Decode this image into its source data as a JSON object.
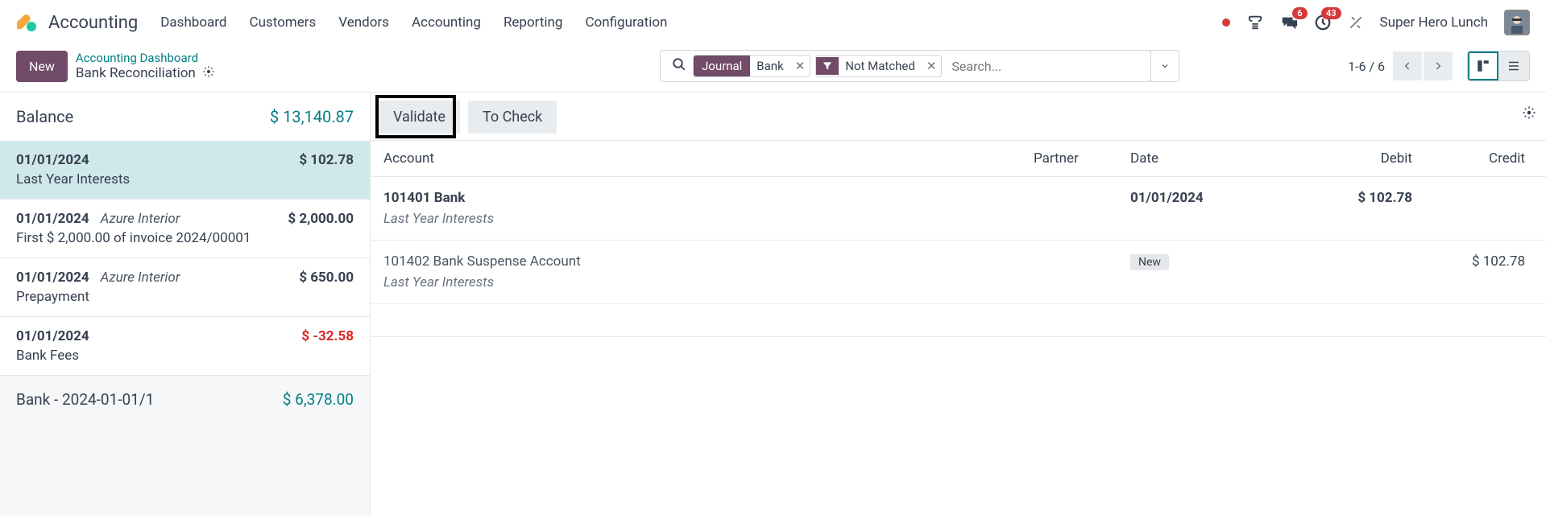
{
  "header": {
    "app": "Accounting",
    "menu": [
      "Dashboard",
      "Customers",
      "Vendors",
      "Accounting",
      "Reporting",
      "Configuration"
    ],
    "chat_badge": "6",
    "activity_badge": "43",
    "company": "Super Hero Lunch"
  },
  "breadcrumb": {
    "new_label": "New",
    "link": "Accounting Dashboard",
    "current": "Bank Reconciliation"
  },
  "search": {
    "chip1_label": "Journal",
    "chip1_value": "Bank",
    "chip2_value": "Not Matched",
    "placeholder": "Search...",
    "pager": "1-6 / 6"
  },
  "sidebar": {
    "balance_label": "Balance",
    "balance_amount": "$ 13,140.87",
    "statements": [
      {
        "date": "01/01/2024",
        "partner": "",
        "amount": "$ 102.78",
        "neg": false,
        "desc": "Last Year Interests",
        "active": true
      },
      {
        "date": "01/01/2024",
        "partner": "Azure Interior",
        "amount": "$ 2,000.00",
        "neg": false,
        "desc": "First $ 2,000.00 of invoice 2024/00001",
        "active": false
      },
      {
        "date": "01/01/2024",
        "partner": "Azure Interior",
        "amount": "$ 650.00",
        "neg": false,
        "desc": "Prepayment",
        "active": false
      },
      {
        "date": "01/01/2024",
        "partner": "",
        "amount": "$ -32.58",
        "neg": true,
        "desc": "Bank Fees",
        "active": false
      }
    ],
    "bank_label": "Bank - 2024-01-01/1",
    "bank_amount": "$ 6,378.00"
  },
  "content": {
    "tabs": {
      "validate": "Validate",
      "to_check": "To Check"
    },
    "columns": {
      "account": "Account",
      "partner": "Partner",
      "date": "Date",
      "debit": "Debit",
      "credit": "Credit"
    },
    "lines": [
      {
        "account": "101401 Bank",
        "desc": "Last Year Interests",
        "partner": "",
        "date": "01/01/2024",
        "debit": "$ 102.78",
        "credit": "",
        "bold": true,
        "new": false
      },
      {
        "account": "101402 Bank Suspense Account",
        "desc": "Last Year Interests",
        "partner": "",
        "date": "",
        "debit": "",
        "credit": "$ 102.78",
        "bold": false,
        "new": true
      }
    ]
  }
}
